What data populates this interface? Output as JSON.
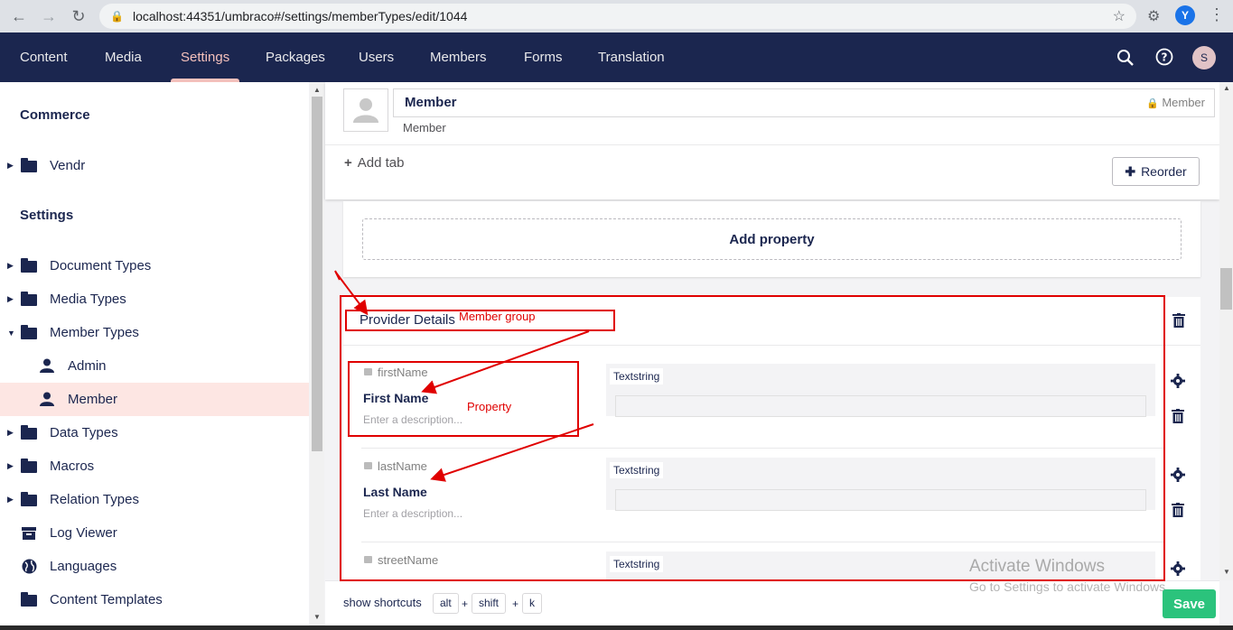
{
  "browser": {
    "url": "localhost:44351/umbraco#/settings/memberTypes/edit/1044",
    "profile_initial": "Y"
  },
  "header": {
    "sections": [
      "Content",
      "Media",
      "Settings",
      "Packages",
      "Users",
      "Members",
      "Forms",
      "Translation"
    ],
    "active_section": "Settings",
    "user_initial": "S"
  },
  "sidebar": {
    "commerce_heading": "Commerce",
    "vendr": "Vendr",
    "settings_heading": "Settings",
    "items": [
      "Document Types",
      "Media Types",
      "Member Types",
      "Admin",
      "Member",
      "Data Types",
      "Macros",
      "Relation Types",
      "Log Viewer",
      "Languages",
      "Content Templates"
    ]
  },
  "editor": {
    "name": "Member",
    "alias_locked": "Member",
    "alias_below": "Member",
    "add_tab": "Add tab",
    "reorder": "Reorder",
    "add_property": "Add property",
    "group_name": "Provider Details",
    "properties": [
      {
        "alias": "firstName",
        "name": "First Name",
        "description": "Enter a description...",
        "editor": "Textstring"
      },
      {
        "alias": "lastName",
        "name": "Last Name",
        "description": "Enter a description...",
        "editor": "Textstring"
      },
      {
        "alias": "streetName",
        "editor": "Textstring"
      }
    ]
  },
  "footer": {
    "show_shortcuts": "show shortcuts",
    "keys": [
      "alt",
      "shift",
      "k"
    ],
    "plus": "+",
    "save": "Save"
  },
  "annotations": {
    "member_group": "Member group",
    "property": "Property"
  },
  "watermark": {
    "line1": "Activate Windows",
    "line2": "Go to Settings to activate Windows."
  },
  "colors": {
    "header_bg": "#1b264f",
    "active_tab": "#f5c1bc",
    "save_green": "#2bc37c",
    "annotation_red": "#e00000"
  }
}
